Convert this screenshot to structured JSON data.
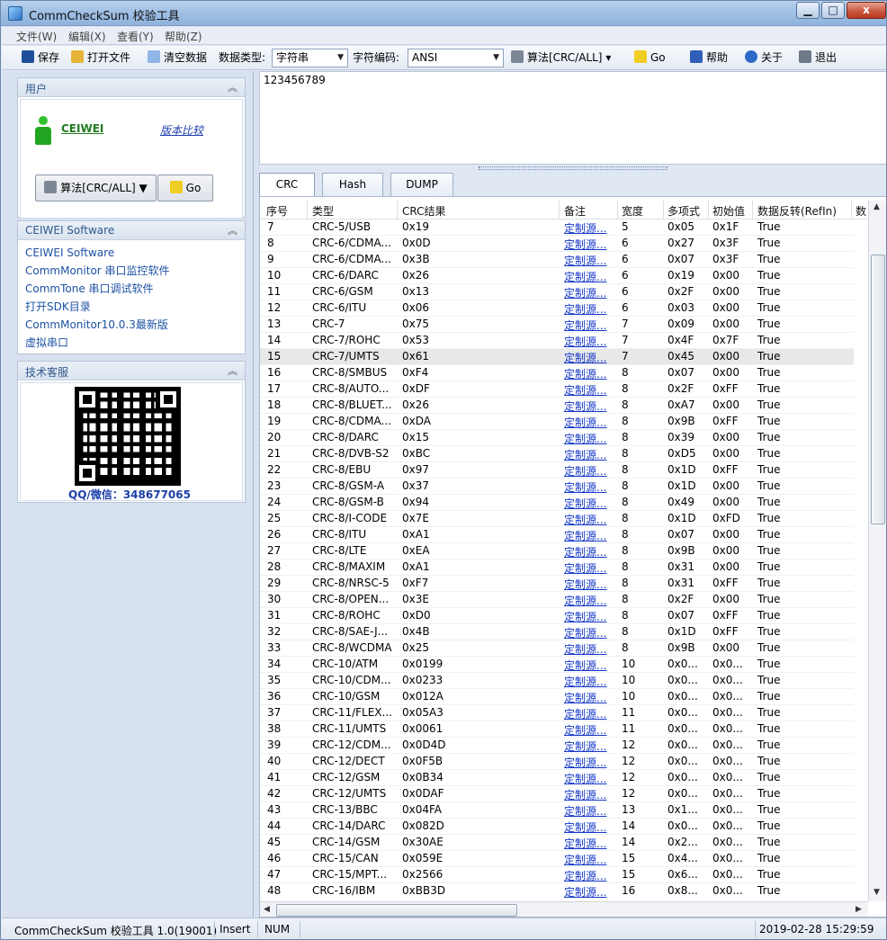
{
  "window": {
    "title": "CommCheckSum 校验工具"
  },
  "menu": [
    "文件(W)",
    "编辑(X)",
    "查看(Y)",
    "帮助(Z)"
  ],
  "toolbar": {
    "save": "保存",
    "open": "打开文件",
    "clear": "清空数据",
    "data_type_label": "数据类型:",
    "data_type_value": "字符串",
    "encoding_label": "字符编码:",
    "encoding_value": "ANSI",
    "algo": "算法[CRC/ALL]",
    "go": "Go",
    "help": "帮助",
    "about": "关于",
    "exit": "退出"
  },
  "user_panel": {
    "title": "用户",
    "username": "CEIWEI",
    "compare_link": "版本比较",
    "algo_button": "算法[CRC/ALL]",
    "go_button": "Go"
  },
  "software_panel": {
    "title": "CEIWEI Software",
    "links": [
      "CEIWEI Software",
      "CommMonitor 串口监控软件",
      "CommTone 串口调试软件",
      "打开SDK目录",
      "CommMonitor10.0.3最新版",
      "虚拟串口"
    ]
  },
  "support_panel": {
    "title": "技术客服",
    "qq": "QQ/微信：348677065"
  },
  "input_text": "123456789",
  "tabs": [
    "CRC",
    "Hash",
    "DUMP"
  ],
  "table": {
    "columns": [
      "序号",
      "类型",
      "CRC结果",
      "备注",
      "宽度",
      "多项式",
      "初始值",
      "数据反转(RefIn)",
      "数"
    ],
    "rows": [
      [
        "7",
        "CRC-5/USB",
        "0x19",
        "定制源...",
        "5",
        "0x05",
        "0x1F",
        "True",
        "Tr"
      ],
      [
        "8",
        "CRC-6/CDMA...",
        "0x0D",
        "定制源...",
        "6",
        "0x27",
        "0x3F",
        "True",
        "Tr"
      ],
      [
        "9",
        "CRC-6/CDMA...",
        "0x3B",
        "定制源...",
        "6",
        "0x07",
        "0x3F",
        "True",
        "Tr"
      ],
      [
        "10",
        "CRC-6/DARC",
        "0x26",
        "定制源...",
        "6",
        "0x19",
        "0x00",
        "True",
        "Tr"
      ],
      [
        "11",
        "CRC-6/GSM",
        "0x13",
        "定制源...",
        "6",
        "0x2F",
        "0x00",
        "True",
        "Tr"
      ],
      [
        "12",
        "CRC-6/ITU",
        "0x06",
        "定制源...",
        "6",
        "0x03",
        "0x00",
        "True",
        "Tr"
      ],
      [
        "13",
        "CRC-7",
        "0x75",
        "定制源...",
        "7",
        "0x09",
        "0x00",
        "True",
        "Tr"
      ],
      [
        "14",
        "CRC-7/ROHC",
        "0x53",
        "定制源...",
        "7",
        "0x4F",
        "0x7F",
        "True",
        "Tr"
      ],
      [
        "15",
        "CRC-7/UMTS",
        "0x61",
        "定制源...",
        "7",
        "0x45",
        "0x00",
        "True",
        "Tr"
      ],
      [
        "16",
        "CRC-8/SMBUS",
        "0xF4",
        "定制源...",
        "8",
        "0x07",
        "0x00",
        "True",
        "Tr"
      ],
      [
        "17",
        "CRC-8/AUTO...",
        "0xDF",
        "定制源...",
        "8",
        "0x2F",
        "0xFF",
        "True",
        "Tr"
      ],
      [
        "18",
        "CRC-8/BLUET...",
        "0x26",
        "定制源...",
        "8",
        "0xA7",
        "0x00",
        "True",
        "Tr"
      ],
      [
        "19",
        "CRC-8/CDMA...",
        "0xDA",
        "定制源...",
        "8",
        "0x9B",
        "0xFF",
        "True",
        "Tr"
      ],
      [
        "20",
        "CRC-8/DARC",
        "0x15",
        "定制源...",
        "8",
        "0x39",
        "0x00",
        "True",
        "Tr"
      ],
      [
        "21",
        "CRC-8/DVB-S2",
        "0xBC",
        "定制源...",
        "8",
        "0xD5",
        "0x00",
        "True",
        "Tr"
      ],
      [
        "22",
        "CRC-8/EBU",
        "0x97",
        "定制源...",
        "8",
        "0x1D",
        "0xFF",
        "True",
        "Tr"
      ],
      [
        "23",
        "CRC-8/GSM-A",
        "0x37",
        "定制源...",
        "8",
        "0x1D",
        "0x00",
        "True",
        "Tr"
      ],
      [
        "24",
        "CRC-8/GSM-B",
        "0x94",
        "定制源...",
        "8",
        "0x49",
        "0x00",
        "True",
        "Tr"
      ],
      [
        "25",
        "CRC-8/I-CODE",
        "0x7E",
        "定制源...",
        "8",
        "0x1D",
        "0xFD",
        "True",
        "Tr"
      ],
      [
        "26",
        "CRC-8/ITU",
        "0xA1",
        "定制源...",
        "8",
        "0x07",
        "0x00",
        "True",
        "Tr"
      ],
      [
        "27",
        "CRC-8/LTE",
        "0xEA",
        "定制源...",
        "8",
        "0x9B",
        "0x00",
        "True",
        "Tr"
      ],
      [
        "28",
        "CRC-8/MAXIM",
        "0xA1",
        "定制源...",
        "8",
        "0x31",
        "0x00",
        "True",
        "Tr"
      ],
      [
        "29",
        "CRC-8/NRSC-5",
        "0xF7",
        "定制源...",
        "8",
        "0x31",
        "0xFF",
        "True",
        "Tr"
      ],
      [
        "30",
        "CRC-8/OPEN...",
        "0x3E",
        "定制源...",
        "8",
        "0x2F",
        "0x00",
        "True",
        "Tr"
      ],
      [
        "31",
        "CRC-8/ROHC",
        "0xD0",
        "定制源...",
        "8",
        "0x07",
        "0xFF",
        "True",
        "Tr"
      ],
      [
        "32",
        "CRC-8/SAE-J...",
        "0x4B",
        "定制源...",
        "8",
        "0x1D",
        "0xFF",
        "True",
        "Tr"
      ],
      [
        "33",
        "CRC-8/WCDMA",
        "0x25",
        "定制源...",
        "8",
        "0x9B",
        "0x00",
        "True",
        "Tr"
      ],
      [
        "34",
        "CRC-10/ATM",
        "0x0199",
        "定制源...",
        "10",
        "0x0...",
        "0x0...",
        "True",
        "Tr"
      ],
      [
        "35",
        "CRC-10/CDM...",
        "0x0233",
        "定制源...",
        "10",
        "0x0...",
        "0x0...",
        "True",
        "Tr"
      ],
      [
        "36",
        "CRC-10/GSM",
        "0x012A",
        "定制源...",
        "10",
        "0x0...",
        "0x0...",
        "True",
        "Tr"
      ],
      [
        "37",
        "CRC-11/FLEX...",
        "0x05A3",
        "定制源...",
        "11",
        "0x0...",
        "0x0...",
        "True",
        "Tr"
      ],
      [
        "38",
        "CRC-11/UMTS",
        "0x0061",
        "定制源...",
        "11",
        "0x0...",
        "0x0...",
        "True",
        "Tr"
      ],
      [
        "39",
        "CRC-12/CDM...",
        "0x0D4D",
        "定制源...",
        "12",
        "0x0...",
        "0x0...",
        "True",
        "Tr"
      ],
      [
        "40",
        "CRC-12/DECT",
        "0x0F5B",
        "定制源...",
        "12",
        "0x0...",
        "0x0...",
        "True",
        "Tr"
      ],
      [
        "41",
        "CRC-12/GSM",
        "0x0B34",
        "定制源...",
        "12",
        "0x0...",
        "0x0...",
        "True",
        "Tr"
      ],
      [
        "42",
        "CRC-12/UMTS",
        "0x0DAF",
        "定制源...",
        "12",
        "0x0...",
        "0x0...",
        "True",
        "Tr"
      ],
      [
        "43",
        "CRC-13/BBC",
        "0x04FA",
        "定制源...",
        "13",
        "0x1...",
        "0x0...",
        "True",
        "Tr"
      ],
      [
        "44",
        "CRC-14/DARC",
        "0x082D",
        "定制源...",
        "14",
        "0x0...",
        "0x0...",
        "True",
        "Tr"
      ],
      [
        "45",
        "CRC-14/GSM",
        "0x30AE",
        "定制源...",
        "14",
        "0x2...",
        "0x0...",
        "True",
        "Tr"
      ],
      [
        "46",
        "CRC-15/CAN",
        "0x059E",
        "定制源...",
        "15",
        "0x4...",
        "0x0...",
        "True",
        "Tr"
      ],
      [
        "47",
        "CRC-15/MPT...",
        "0x2566",
        "定制源...",
        "15",
        "0x6...",
        "0x0...",
        "True",
        "Tr"
      ],
      [
        "48",
        "CRC-16/IBM",
        "0xBB3D",
        "定制源...",
        "16",
        "0x8...",
        "0x0...",
        "True",
        "Tr"
      ]
    ],
    "selected_row_index": 8
  },
  "status": {
    "app": "CommCheckSum 校验工具 1.0(19001)",
    "mode": "Insert",
    "num": "NUM",
    "datetime": "2019-02-28 15:29:59"
  }
}
